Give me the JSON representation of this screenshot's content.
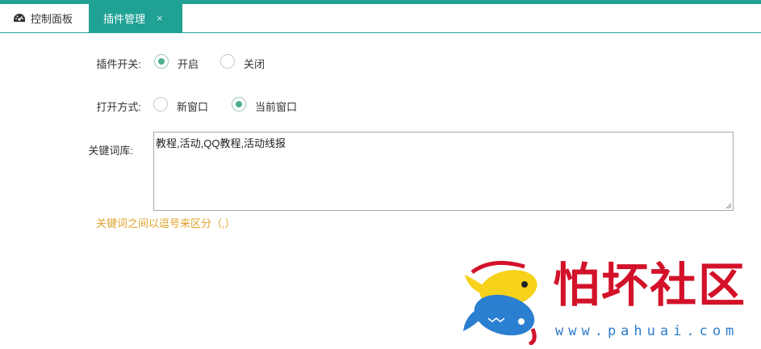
{
  "tabs": [
    {
      "label": "控制面板",
      "icon": "dashboard-icon",
      "active": false
    },
    {
      "label": "插件管理",
      "active": true,
      "close_icon": "×"
    }
  ],
  "form": {
    "plugin_switch": {
      "label": "插件开关:",
      "options": [
        {
          "label": "开启",
          "checked": true
        },
        {
          "label": "关闭",
          "checked": false
        }
      ]
    },
    "open_mode": {
      "label": "打开方式:",
      "options": [
        {
          "label": "新窗口",
          "checked": false
        },
        {
          "label": "当前窗口",
          "checked": true
        }
      ]
    },
    "keywords": {
      "label": "关键词库:",
      "value": "教程,活动,QQ教程,活动线报",
      "hint": "关键词之间以逗号来区分（,）"
    }
  },
  "watermark": {
    "title": "怕坏社区",
    "url": "www.pahuai.com"
  },
  "colors": {
    "accent": "#1fa194",
    "radio_checked": "#4caf8e",
    "hint": "#e0a22b",
    "watermark_red": "#d3122a",
    "watermark_blue": "#2e7cc9"
  }
}
